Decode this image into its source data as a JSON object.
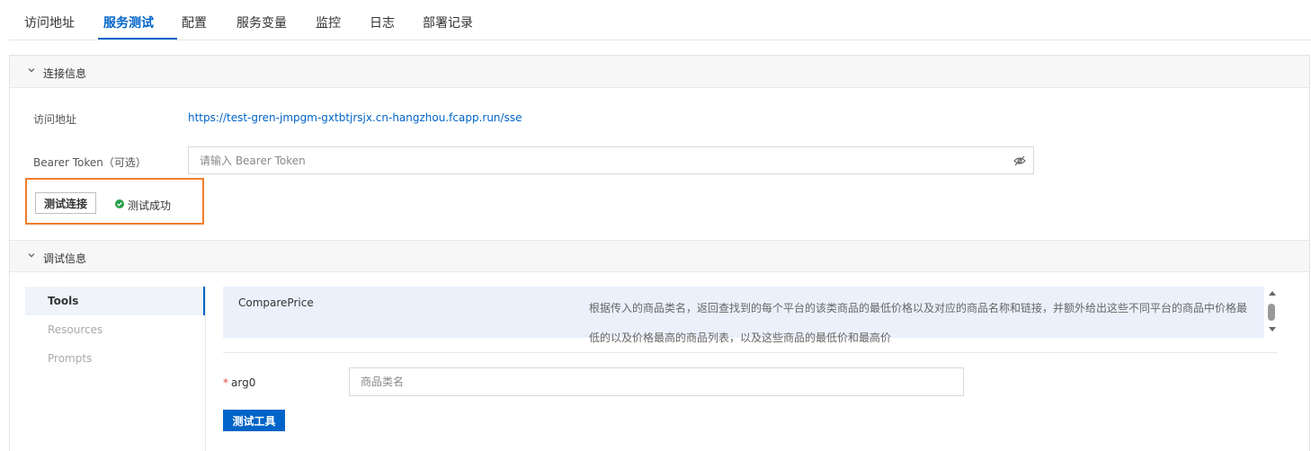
{
  "tabs": [
    {
      "label": "访问地址"
    },
    {
      "label": "服务测试",
      "active": true
    },
    {
      "label": "配置"
    },
    {
      "label": "服务变量"
    },
    {
      "label": "监控"
    },
    {
      "label": "日志"
    },
    {
      "label": "部署记录"
    }
  ],
  "connection": {
    "section_title": "连接信息",
    "url_label": "访问地址",
    "url_value": "https://test-gren-jmpgm-gxtbtjrsjx.cn-hangzhou.fcapp.run/sse",
    "token_label": "Bearer Token（可选）",
    "token_placeholder": "请输入 Bearer Token",
    "token_value": "",
    "test_button": "测试连接",
    "status_text": "测试成功",
    "status_color": "#27a148"
  },
  "debug": {
    "section_title": "调试信息",
    "nav": [
      {
        "label": "Tools",
        "active": true
      },
      {
        "label": "Resources"
      },
      {
        "label": "Prompts"
      }
    ],
    "tool": {
      "name": "ComparePrice",
      "description": "根据传入的商品类名，返回查找到的每个平台的该类商品的最低价格以及对应的商品名称和链接，并额外给出这些不同平台的商品中价格最低的以及价格最高的商品列表，以及这些商品的最低价和最高价"
    },
    "arg": {
      "required_mark": "*",
      "label": "arg0",
      "placeholder": "商品类名",
      "value": ""
    },
    "submit_button": "测试工具"
  },
  "colors": {
    "accent": "#0064c8",
    "highlight_border": "#f07d2b",
    "success": "#27a148"
  }
}
